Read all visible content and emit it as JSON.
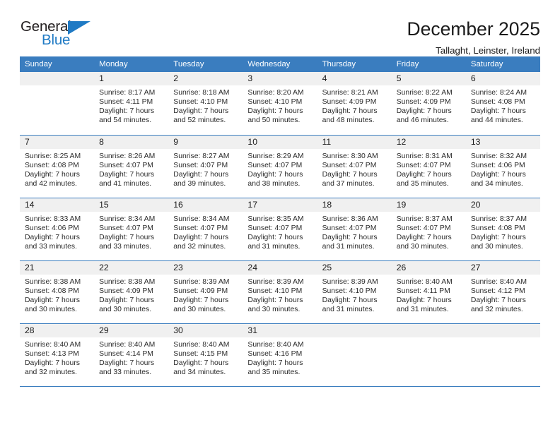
{
  "brand": {
    "name_top": "General",
    "name_bottom": "Blue",
    "accent_color": "#1f7ac4",
    "text_color": "#231f20"
  },
  "header": {
    "title": "December 2025",
    "subtitle": "Tallaght, Leinster, Ireland"
  },
  "calendar": {
    "header_bg": "#3a7dbf",
    "daynum_bg": "#f0f0f0",
    "weekdays": [
      "Sunday",
      "Monday",
      "Tuesday",
      "Wednesday",
      "Thursday",
      "Friday",
      "Saturday"
    ],
    "weeks": [
      [
        {
          "day": "",
          "empty": true,
          "sunrise": "",
          "sunset": "",
          "daylight1": "",
          "daylight2": ""
        },
        {
          "day": "1",
          "sunrise": "Sunrise: 8:17 AM",
          "sunset": "Sunset: 4:11 PM",
          "daylight1": "Daylight: 7 hours",
          "daylight2": "and 54 minutes."
        },
        {
          "day": "2",
          "sunrise": "Sunrise: 8:18 AM",
          "sunset": "Sunset: 4:10 PM",
          "daylight1": "Daylight: 7 hours",
          "daylight2": "and 52 minutes."
        },
        {
          "day": "3",
          "sunrise": "Sunrise: 8:20 AM",
          "sunset": "Sunset: 4:10 PM",
          "daylight1": "Daylight: 7 hours",
          "daylight2": "and 50 minutes."
        },
        {
          "day": "4",
          "sunrise": "Sunrise: 8:21 AM",
          "sunset": "Sunset: 4:09 PM",
          "daylight1": "Daylight: 7 hours",
          "daylight2": "and 48 minutes."
        },
        {
          "day": "5",
          "sunrise": "Sunrise: 8:22 AM",
          "sunset": "Sunset: 4:09 PM",
          "daylight1": "Daylight: 7 hours",
          "daylight2": "and 46 minutes."
        },
        {
          "day": "6",
          "sunrise": "Sunrise: 8:24 AM",
          "sunset": "Sunset: 4:08 PM",
          "daylight1": "Daylight: 7 hours",
          "daylight2": "and 44 minutes."
        }
      ],
      [
        {
          "day": "7",
          "sunrise": "Sunrise: 8:25 AM",
          "sunset": "Sunset: 4:08 PM",
          "daylight1": "Daylight: 7 hours",
          "daylight2": "and 42 minutes."
        },
        {
          "day": "8",
          "sunrise": "Sunrise: 8:26 AM",
          "sunset": "Sunset: 4:07 PM",
          "daylight1": "Daylight: 7 hours",
          "daylight2": "and 41 minutes."
        },
        {
          "day": "9",
          "sunrise": "Sunrise: 8:27 AM",
          "sunset": "Sunset: 4:07 PM",
          "daylight1": "Daylight: 7 hours",
          "daylight2": "and 39 minutes."
        },
        {
          "day": "10",
          "sunrise": "Sunrise: 8:29 AM",
          "sunset": "Sunset: 4:07 PM",
          "daylight1": "Daylight: 7 hours",
          "daylight2": "and 38 minutes."
        },
        {
          "day": "11",
          "sunrise": "Sunrise: 8:30 AM",
          "sunset": "Sunset: 4:07 PM",
          "daylight1": "Daylight: 7 hours",
          "daylight2": "and 37 minutes."
        },
        {
          "day": "12",
          "sunrise": "Sunrise: 8:31 AM",
          "sunset": "Sunset: 4:07 PM",
          "daylight1": "Daylight: 7 hours",
          "daylight2": "and 35 minutes."
        },
        {
          "day": "13",
          "sunrise": "Sunrise: 8:32 AM",
          "sunset": "Sunset: 4:06 PM",
          "daylight1": "Daylight: 7 hours",
          "daylight2": "and 34 minutes."
        }
      ],
      [
        {
          "day": "14",
          "sunrise": "Sunrise: 8:33 AM",
          "sunset": "Sunset: 4:06 PM",
          "daylight1": "Daylight: 7 hours",
          "daylight2": "and 33 minutes."
        },
        {
          "day": "15",
          "sunrise": "Sunrise: 8:34 AM",
          "sunset": "Sunset: 4:07 PM",
          "daylight1": "Daylight: 7 hours",
          "daylight2": "and 33 minutes."
        },
        {
          "day": "16",
          "sunrise": "Sunrise: 8:34 AM",
          "sunset": "Sunset: 4:07 PM",
          "daylight1": "Daylight: 7 hours",
          "daylight2": "and 32 minutes."
        },
        {
          "day": "17",
          "sunrise": "Sunrise: 8:35 AM",
          "sunset": "Sunset: 4:07 PM",
          "daylight1": "Daylight: 7 hours",
          "daylight2": "and 31 minutes."
        },
        {
          "day": "18",
          "sunrise": "Sunrise: 8:36 AM",
          "sunset": "Sunset: 4:07 PM",
          "daylight1": "Daylight: 7 hours",
          "daylight2": "and 31 minutes."
        },
        {
          "day": "19",
          "sunrise": "Sunrise: 8:37 AM",
          "sunset": "Sunset: 4:07 PM",
          "daylight1": "Daylight: 7 hours",
          "daylight2": "and 30 minutes."
        },
        {
          "day": "20",
          "sunrise": "Sunrise: 8:37 AM",
          "sunset": "Sunset: 4:08 PM",
          "daylight1": "Daylight: 7 hours",
          "daylight2": "and 30 minutes."
        }
      ],
      [
        {
          "day": "21",
          "sunrise": "Sunrise: 8:38 AM",
          "sunset": "Sunset: 4:08 PM",
          "daylight1": "Daylight: 7 hours",
          "daylight2": "and 30 minutes."
        },
        {
          "day": "22",
          "sunrise": "Sunrise: 8:38 AM",
          "sunset": "Sunset: 4:09 PM",
          "daylight1": "Daylight: 7 hours",
          "daylight2": "and 30 minutes."
        },
        {
          "day": "23",
          "sunrise": "Sunrise: 8:39 AM",
          "sunset": "Sunset: 4:09 PM",
          "daylight1": "Daylight: 7 hours",
          "daylight2": "and 30 minutes."
        },
        {
          "day": "24",
          "sunrise": "Sunrise: 8:39 AM",
          "sunset": "Sunset: 4:10 PM",
          "daylight1": "Daylight: 7 hours",
          "daylight2": "and 30 minutes."
        },
        {
          "day": "25",
          "sunrise": "Sunrise: 8:39 AM",
          "sunset": "Sunset: 4:10 PM",
          "daylight1": "Daylight: 7 hours",
          "daylight2": "and 31 minutes."
        },
        {
          "day": "26",
          "sunrise": "Sunrise: 8:40 AM",
          "sunset": "Sunset: 4:11 PM",
          "daylight1": "Daylight: 7 hours",
          "daylight2": "and 31 minutes."
        },
        {
          "day": "27",
          "sunrise": "Sunrise: 8:40 AM",
          "sunset": "Sunset: 4:12 PM",
          "daylight1": "Daylight: 7 hours",
          "daylight2": "and 32 minutes."
        }
      ],
      [
        {
          "day": "28",
          "sunrise": "Sunrise: 8:40 AM",
          "sunset": "Sunset: 4:13 PM",
          "daylight1": "Daylight: 7 hours",
          "daylight2": "and 32 minutes."
        },
        {
          "day": "29",
          "sunrise": "Sunrise: 8:40 AM",
          "sunset": "Sunset: 4:14 PM",
          "daylight1": "Daylight: 7 hours",
          "daylight2": "and 33 minutes."
        },
        {
          "day": "30",
          "sunrise": "Sunrise: 8:40 AM",
          "sunset": "Sunset: 4:15 PM",
          "daylight1": "Daylight: 7 hours",
          "daylight2": "and 34 minutes."
        },
        {
          "day": "31",
          "sunrise": "Sunrise: 8:40 AM",
          "sunset": "Sunset: 4:16 PM",
          "daylight1": "Daylight: 7 hours",
          "daylight2": "and 35 minutes."
        },
        {
          "day": "",
          "empty": true,
          "sunrise": "",
          "sunset": "",
          "daylight1": "",
          "daylight2": ""
        },
        {
          "day": "",
          "empty": true,
          "sunrise": "",
          "sunset": "",
          "daylight1": "",
          "daylight2": ""
        },
        {
          "day": "",
          "empty": true,
          "sunrise": "",
          "sunset": "",
          "daylight1": "",
          "daylight2": ""
        }
      ]
    ]
  }
}
